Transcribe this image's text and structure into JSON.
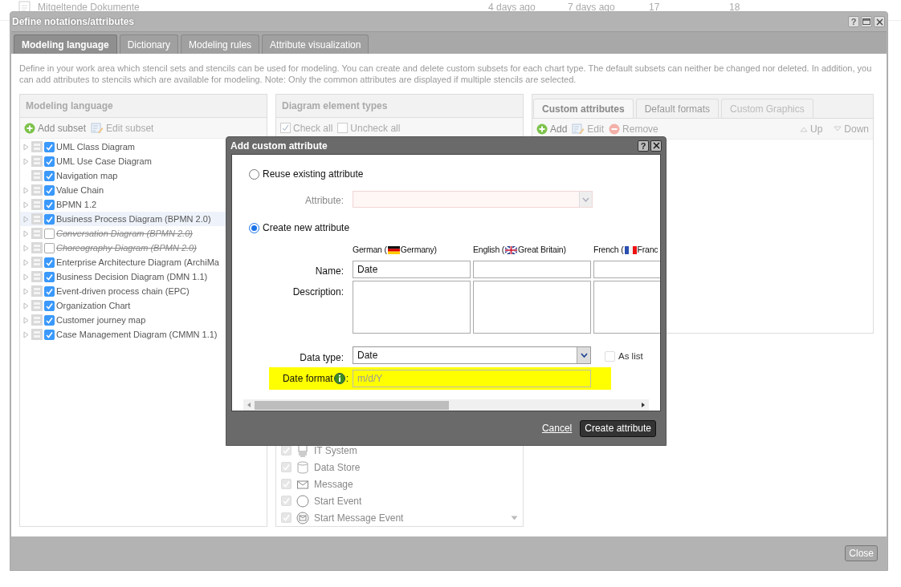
{
  "background_page": {
    "rows": [
      {
        "column_1": "Mitgeltende Dokumente",
        "column_2": "4 days ago",
        "column_3": "7 days ago",
        "column_4": "17",
        "column_5": "18"
      }
    ]
  },
  "dialog": {
    "title": "Define notations/attributes",
    "help": "?",
    "tabs": [
      {
        "label": "Modeling language",
        "selected": true
      },
      {
        "label": "Dictionary",
        "selected": false
      },
      {
        "label": "Modeling rules",
        "selected": false
      },
      {
        "label": "Attribute visualization",
        "selected": false
      }
    ],
    "description": "Define in your work area which stencil sets and stencils can be used for modeling. You can create and delete custom subsets for each chart type. The default subsets can neither be changed nor deleted. In addition, you can add attributes to stencils which are available for modeling. Note: Only the common attributes are displayed if multiple stencils are selected.",
    "modeling_language": {
      "title": "Modeling language",
      "toolbar": [
        {
          "label": "Add subset",
          "kind": "add",
          "disabled": false
        },
        {
          "label": "Edit subset",
          "kind": "edit",
          "disabled": true
        }
      ],
      "items": [
        {
          "label": "UML Class Diagram",
          "checked": true,
          "expandable": true,
          "selected": false
        },
        {
          "label": "UML Use Case Diagram",
          "checked": true,
          "expandable": true,
          "selected": false
        },
        {
          "label": "Navigation map",
          "checked": true,
          "expandable": false,
          "selected": false
        },
        {
          "label": "Value Chain",
          "checked": true,
          "expandable": true,
          "selected": false
        },
        {
          "label": "BPMN 1.2",
          "checked": true,
          "expandable": true,
          "selected": false
        },
        {
          "label": "Business Process Diagram (BPMN 2.0)",
          "checked": true,
          "expandable": true,
          "selected": true
        },
        {
          "label": "Conversation Diagram (BPMN 2.0)",
          "checked": false,
          "expandable": true,
          "selected": false
        },
        {
          "label": "Choreography Diagram (BPMN 2.0)",
          "checked": false,
          "expandable": true,
          "selected": false
        },
        {
          "label": "Enterprise Architecture Diagram (ArchiMa",
          "checked": true,
          "expandable": true,
          "selected": false
        },
        {
          "label": "Business Decision Diagram (DMN 1.1)",
          "checked": true,
          "expandable": true,
          "selected": false
        },
        {
          "label": "Event-driven process chain (EPC)",
          "checked": true,
          "expandable": true,
          "selected": false
        },
        {
          "label": "Organization Chart",
          "checked": true,
          "expandable": true,
          "selected": false
        },
        {
          "label": "Customer journey map",
          "checked": true,
          "expandable": true,
          "selected": false
        },
        {
          "label": "Case Management Diagram (CMMN 1.1)",
          "checked": true,
          "expandable": true,
          "selected": false
        }
      ]
    },
    "element_types": {
      "title": "Diagram element types",
      "check_all": "Check all",
      "uncheck_all": "Uncheck all",
      "items": [
        {
          "label": "IT System",
          "kind": "computer",
          "checked": true
        },
        {
          "label": "Data Store",
          "kind": "database",
          "checked": true
        },
        {
          "label": "Message",
          "kind": "envelope",
          "checked": true
        },
        {
          "label": "Start Event",
          "kind": "circle",
          "checked": true
        },
        {
          "label": "Start Message Event",
          "kind": "circle-envelope",
          "checked": true
        }
      ]
    },
    "attributes": {
      "tabs": [
        {
          "label": "Custom attributes",
          "selected": true,
          "disabled": false
        },
        {
          "label": "Default formats",
          "selected": false,
          "disabled": false
        },
        {
          "label": "Custom Graphics",
          "selected": false,
          "disabled": true
        }
      ],
      "toolbar": [
        {
          "label": "Add",
          "kind": "add",
          "disabled": false
        },
        {
          "label": "Edit",
          "kind": "edit",
          "disabled": true
        },
        {
          "label": "Remove",
          "kind": "remove",
          "disabled": true
        }
      ],
      "order_buttons": [
        {
          "label": "Up",
          "kind": "up",
          "disabled": true
        },
        {
          "label": "Down",
          "kind": "down",
          "disabled": true
        }
      ]
    },
    "close_button": "Close"
  },
  "modal": {
    "title": "Add custom attribute",
    "help": "?",
    "options": [
      {
        "label": "Reuse existing attribute",
        "selected": false
      },
      {
        "label": "Create new attribute",
        "selected": true
      }
    ],
    "attribute_label": "Attribute:",
    "languages": [
      {
        "language": "German (",
        "country": "Germany)",
        "name": "Date"
      },
      {
        "language": "English (",
        "country": "Great Britain)"
      },
      {
        "language": "French (",
        "country": "Franc"
      }
    ],
    "name_label": "Name:",
    "description_label": "Description:",
    "data_type_label": "Data type:",
    "data_type": "Date",
    "as_list": {
      "label": "As list",
      "checked": false
    },
    "date_format": {
      "label": "Date format",
      "suffix": ":",
      "placeholder": "m/d/Y",
      "highlighted": true
    },
    "cancel": "Cancel",
    "create": "Create attribute"
  }
}
